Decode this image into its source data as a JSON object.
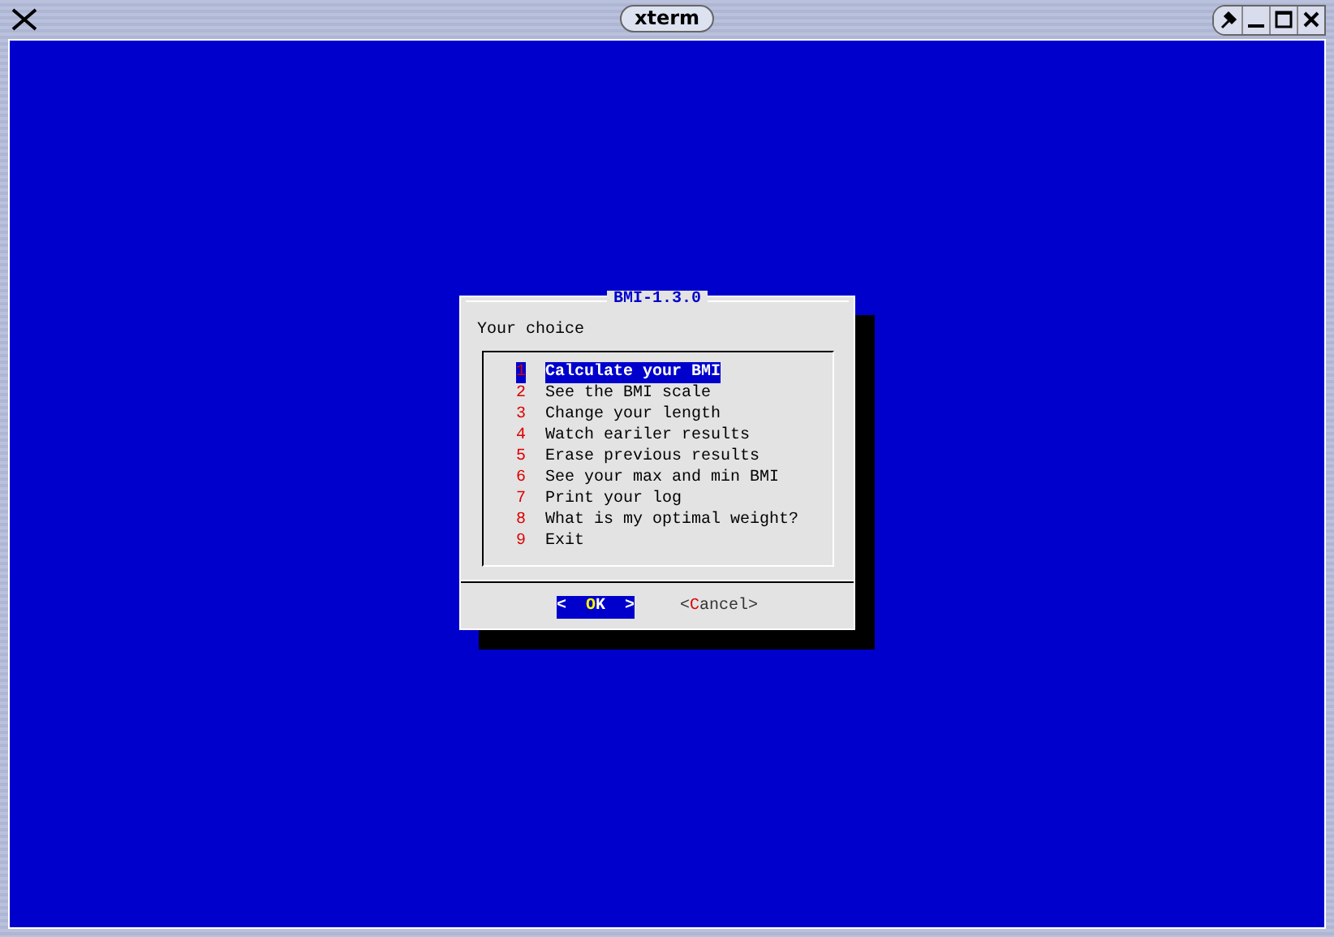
{
  "window": {
    "title": "xterm"
  },
  "dialog": {
    "title": "BMI-1.3.0",
    "prompt": "Your choice",
    "items": [
      {
        "number": "1",
        "label": "Calculate your BMI",
        "selected": true
      },
      {
        "number": "2",
        "label": "See the BMI scale",
        "selected": false
      },
      {
        "number": "3",
        "label": "Change your length",
        "selected": false
      },
      {
        "number": "4",
        "label": "Watch eariler results",
        "selected": false
      },
      {
        "number": "5",
        "label": "Erase previous results",
        "selected": false
      },
      {
        "number": "6",
        "label": "See your max and min BMI",
        "selected": false
      },
      {
        "number": "7",
        "label": "Print your log",
        "selected": false
      },
      {
        "number": "8",
        "label": "What is my optimal weight?",
        "selected": false
      },
      {
        "number": "9",
        "label": "Exit",
        "selected": false
      }
    ],
    "buttons": [
      {
        "open": "<  ",
        "hotkey": "O",
        "rest": "K",
        "close": "  >",
        "selected": true
      },
      {
        "open": "<",
        "hotkey": "C",
        "rest": "ancel",
        "close": ">",
        "selected": false
      }
    ]
  }
}
